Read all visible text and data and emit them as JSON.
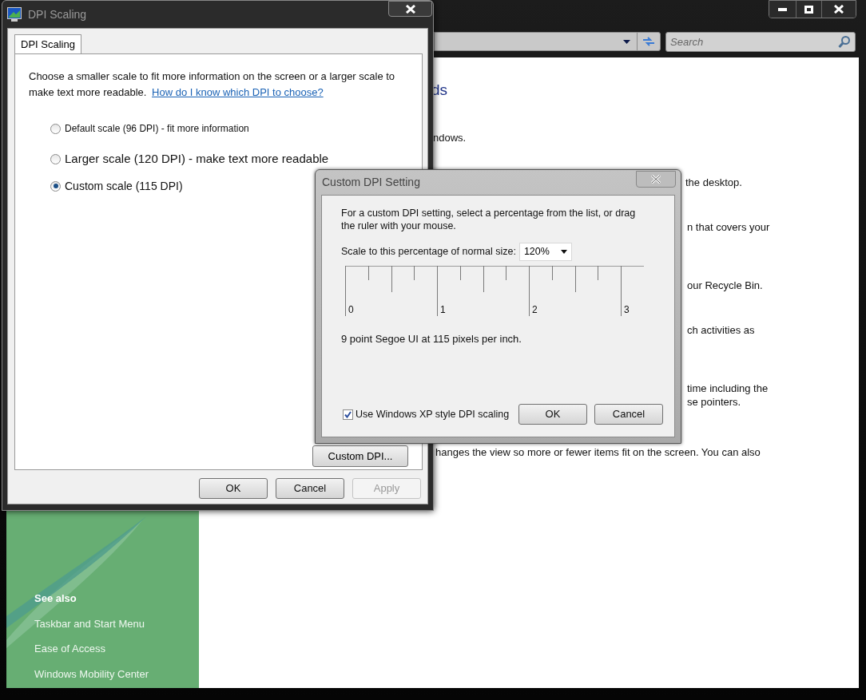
{
  "explorer_window": {
    "search": {
      "placeholder": "Search"
    },
    "content_fragments": [
      {
        "kind": "heading",
        "text": "ds"
      },
      {
        "kind": "text",
        "text": "ndows."
      },
      {
        "kind": "text",
        "text": "the desktop."
      },
      {
        "kind": "text",
        "text": "n that covers your"
      },
      {
        "kind": "text",
        "text": "our Recycle Bin."
      },
      {
        "kind": "text",
        "text": "ch activities as"
      },
      {
        "kind": "text",
        "text": "time including the"
      },
      {
        "kind": "text",
        "text": "se pointers."
      },
      {
        "kind": "text",
        "text": "hanges the view so more or fewer items fit on the screen. You can also"
      }
    ],
    "see_also": {
      "heading": "See also",
      "links": [
        "Taskbar and Start Menu",
        "Ease of Access",
        "Windows Mobility Center"
      ]
    }
  },
  "dpi_window": {
    "title": "DPI Scaling",
    "tabs": [
      {
        "label": "DPI Scaling",
        "selected": true
      }
    ],
    "description": "Choose a smaller scale to fit more information on the screen or a larger scale to make text more readable.",
    "help_link": "How do I know which DPI to choose?",
    "options": [
      {
        "label": "Default scale (96 DPI) - fit more information",
        "selected": false
      },
      {
        "label": "Larger scale (120 DPI) - make text more readable",
        "selected": false
      },
      {
        "label": "Custom scale (115 DPI)",
        "selected": true
      }
    ],
    "custom_button": "Custom DPI...",
    "buttons": [
      {
        "label": "OK",
        "disabled": false
      },
      {
        "label": "Cancel",
        "disabled": false
      },
      {
        "label": "Apply",
        "disabled": true
      }
    ]
  },
  "custom_dpi_dialog": {
    "title": "Custom DPI Setting",
    "instructions": "For a custom DPI setting, select a percentage from the list, or drag the ruler with your mouse.",
    "scale_label": "Scale to this percentage of normal size:",
    "scale_value": "120%",
    "ruler_labels": [
      "0",
      "1",
      "2",
      "3"
    ],
    "sample_text": "9 point Segoe UI at 115 pixels per inch.",
    "xp_style": {
      "label": "Use Windows XP style DPI scaling",
      "checked": true
    },
    "buttons": [
      {
        "label": "OK"
      },
      {
        "label": "Cancel"
      }
    ]
  }
}
